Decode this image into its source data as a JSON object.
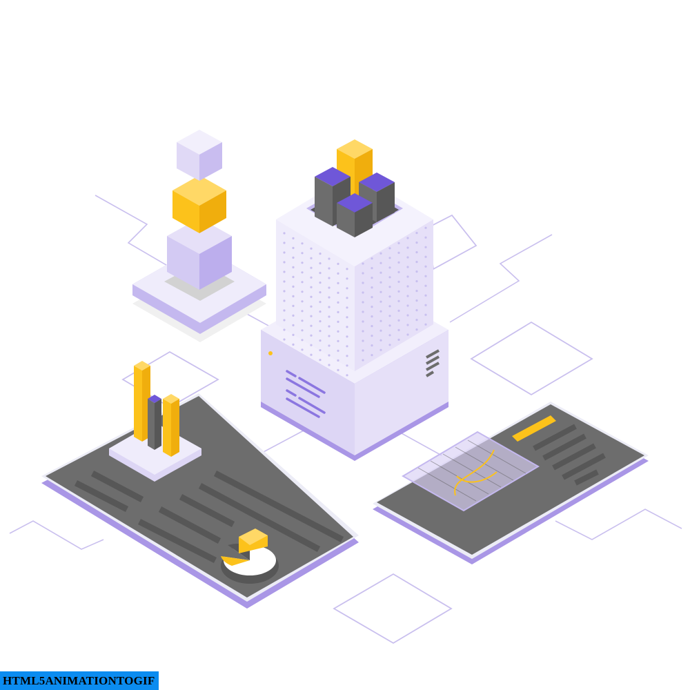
{
  "watermark": {
    "text": "HTML5ANIMATIONTOGIF"
  },
  "palette": {
    "lavender_light": "#efecfb",
    "lavender": "#ddd6f5",
    "lavender_mid": "#c4b8ef",
    "lavender_dark": "#a996e6",
    "purple": "#6f57d8",
    "purple_dark": "#5a45bf",
    "yellow": "#fcc21b",
    "yellow_light": "#ffd866",
    "yellow_dark": "#e6a800",
    "dark_gray": "#575757",
    "mid_gray": "#6d6d6d",
    "line": "#c9bfee",
    "dot": "#c8bfef"
  },
  "icons": [
    "server-tower",
    "stacked-cubes",
    "bar-chart-panel",
    "pie-chart",
    "line-chart-screen"
  ]
}
